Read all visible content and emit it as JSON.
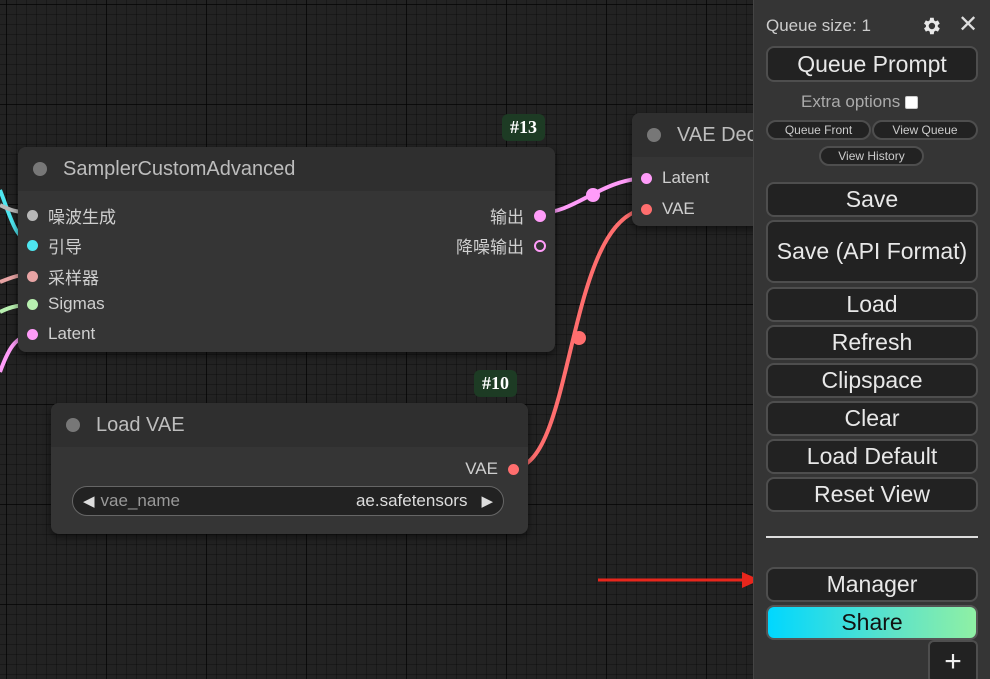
{
  "nodes": {
    "sampler": {
      "id_badge": "#13",
      "title": "SamplerCustomAdvanced",
      "inputs": [
        "噪波生成",
        "引导",
        "采样器",
        "Sigmas",
        "Latent"
      ],
      "outputs": [
        "输出",
        "降噪输出"
      ]
    },
    "load_vae": {
      "id_badge": "#10",
      "title": "Load VAE",
      "output": "VAE",
      "widget_name": "vae_name",
      "widget_value": "ae.safetensors"
    },
    "vae_decode": {
      "title": "VAE Dec",
      "inputs": [
        "Latent",
        "VAE"
      ]
    }
  },
  "menu": {
    "queue_size": "Queue size: 1",
    "queue_prompt": "Queue Prompt",
    "extra_options": "Extra options",
    "queue_front": "Queue Front",
    "view_queue": "View Queue",
    "view_history": "View History",
    "save": "Save",
    "save_api": "Save (API Format)",
    "load": "Load",
    "refresh": "Refresh",
    "clipspace": "Clipspace",
    "clear": "Clear",
    "load_default": "Load Default",
    "reset_view": "Reset View",
    "manager": "Manager",
    "share": "Share",
    "plus": "+",
    "close": "✕"
  },
  "colors": {
    "noise": "#b8b8b8",
    "guider": "#4ee6f0",
    "sampler": "#e8a4a4",
    "sigmas": "#b8f0b0",
    "latent": "#ff9cf9",
    "vae": "#ff6e6e",
    "annotation_arrow": "#e8261c"
  },
  "icons": {
    "settings": "gear-icon",
    "close": "close-icon",
    "left": "arrow-left-icon",
    "right": "arrow-right-icon"
  }
}
